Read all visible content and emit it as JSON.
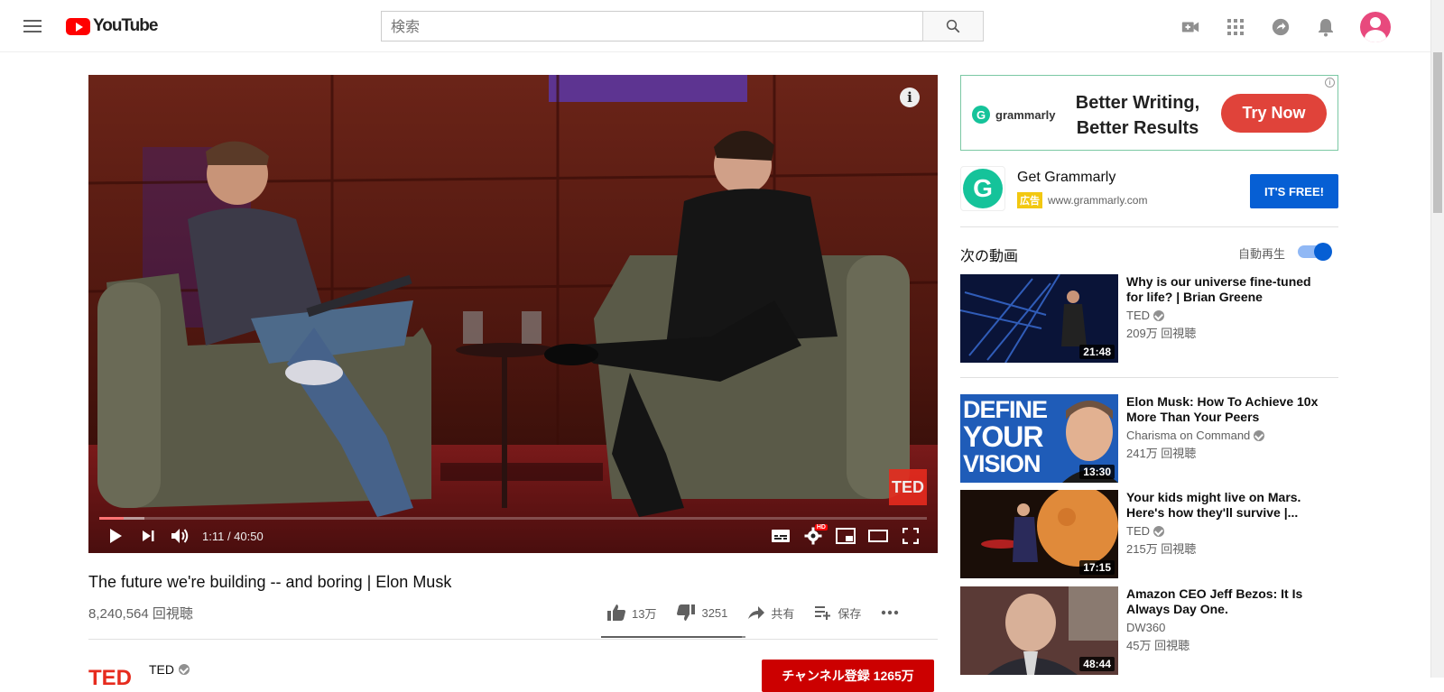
{
  "header": {
    "logo_text": "YouTube",
    "search_placeholder": "検索",
    "icons": [
      "menu-icon",
      "search-icon",
      "create-video-icon",
      "apps-grid-icon",
      "share-messages-icon",
      "notifications-bell-icon",
      "account-avatar"
    ]
  },
  "player": {
    "current_time": "1:11",
    "duration": "40:50",
    "time_display": "1:11 / 40:50",
    "progress_fraction": 0.029,
    "loaded_fraction": 0.055,
    "watermark": "TED",
    "info_label": "i",
    "quality_badge": "HD"
  },
  "video": {
    "title": "The future we're building -- and boring | Elon Musk",
    "views": "8,240,564 回視聴",
    "likes": "13万",
    "dislikes": "3251",
    "share_label": "共有",
    "save_label": "保存",
    "like_ratio": 0.976
  },
  "channel": {
    "logo": "TED",
    "name": "TED",
    "subscribe_label": "チャンネル登録 1265万"
  },
  "ad": {
    "banner_brand": "grammarly",
    "banner_brand_icon": "G",
    "banner_headline_1": "Better Writing,",
    "banner_headline_2": "Better Results",
    "banner_cta": "Try Now",
    "card_name": "Get Grammarly",
    "card_badge": "広告",
    "card_url": "www.grammarly.com",
    "card_cta": "IT'S FREE!",
    "info_icon": "i"
  },
  "sidebar": {
    "up_next_label": "次の動画",
    "autoplay_label": "自動再生",
    "autoplay_on": true,
    "recommendations": [
      {
        "title": "Why is our universe fine-tuned for life? | Brian Greene",
        "channel": "TED",
        "verified": true,
        "views": "209万 回視聴",
        "duration": "21:48"
      },
      {
        "title": "Elon Musk: How To Achieve 10x More Than Your Peers",
        "channel": "Charisma on Command",
        "verified": true,
        "views": "241万 回視聴",
        "duration": "13:30",
        "thumb_text": [
          "DEFINE",
          "YOUR",
          "VISION"
        ]
      },
      {
        "title": "Your kids might live on Mars. Here's how they'll survive |...",
        "channel": "TED",
        "verified": true,
        "views": "215万 回視聴",
        "duration": "17:15"
      },
      {
        "title": "Amazon CEO Jeff Bezos: It Is Always Day One.",
        "channel": "DW360",
        "verified": false,
        "views": "45万 回視聴",
        "duration": "48:44"
      }
    ]
  },
  "colors": {
    "youtube_red": "#ff0000",
    "subscribe_red": "#cc0000",
    "blue_accent": "#065fd4",
    "grammarly_green": "#15c39a",
    "ted_red": "#e62b1e"
  }
}
